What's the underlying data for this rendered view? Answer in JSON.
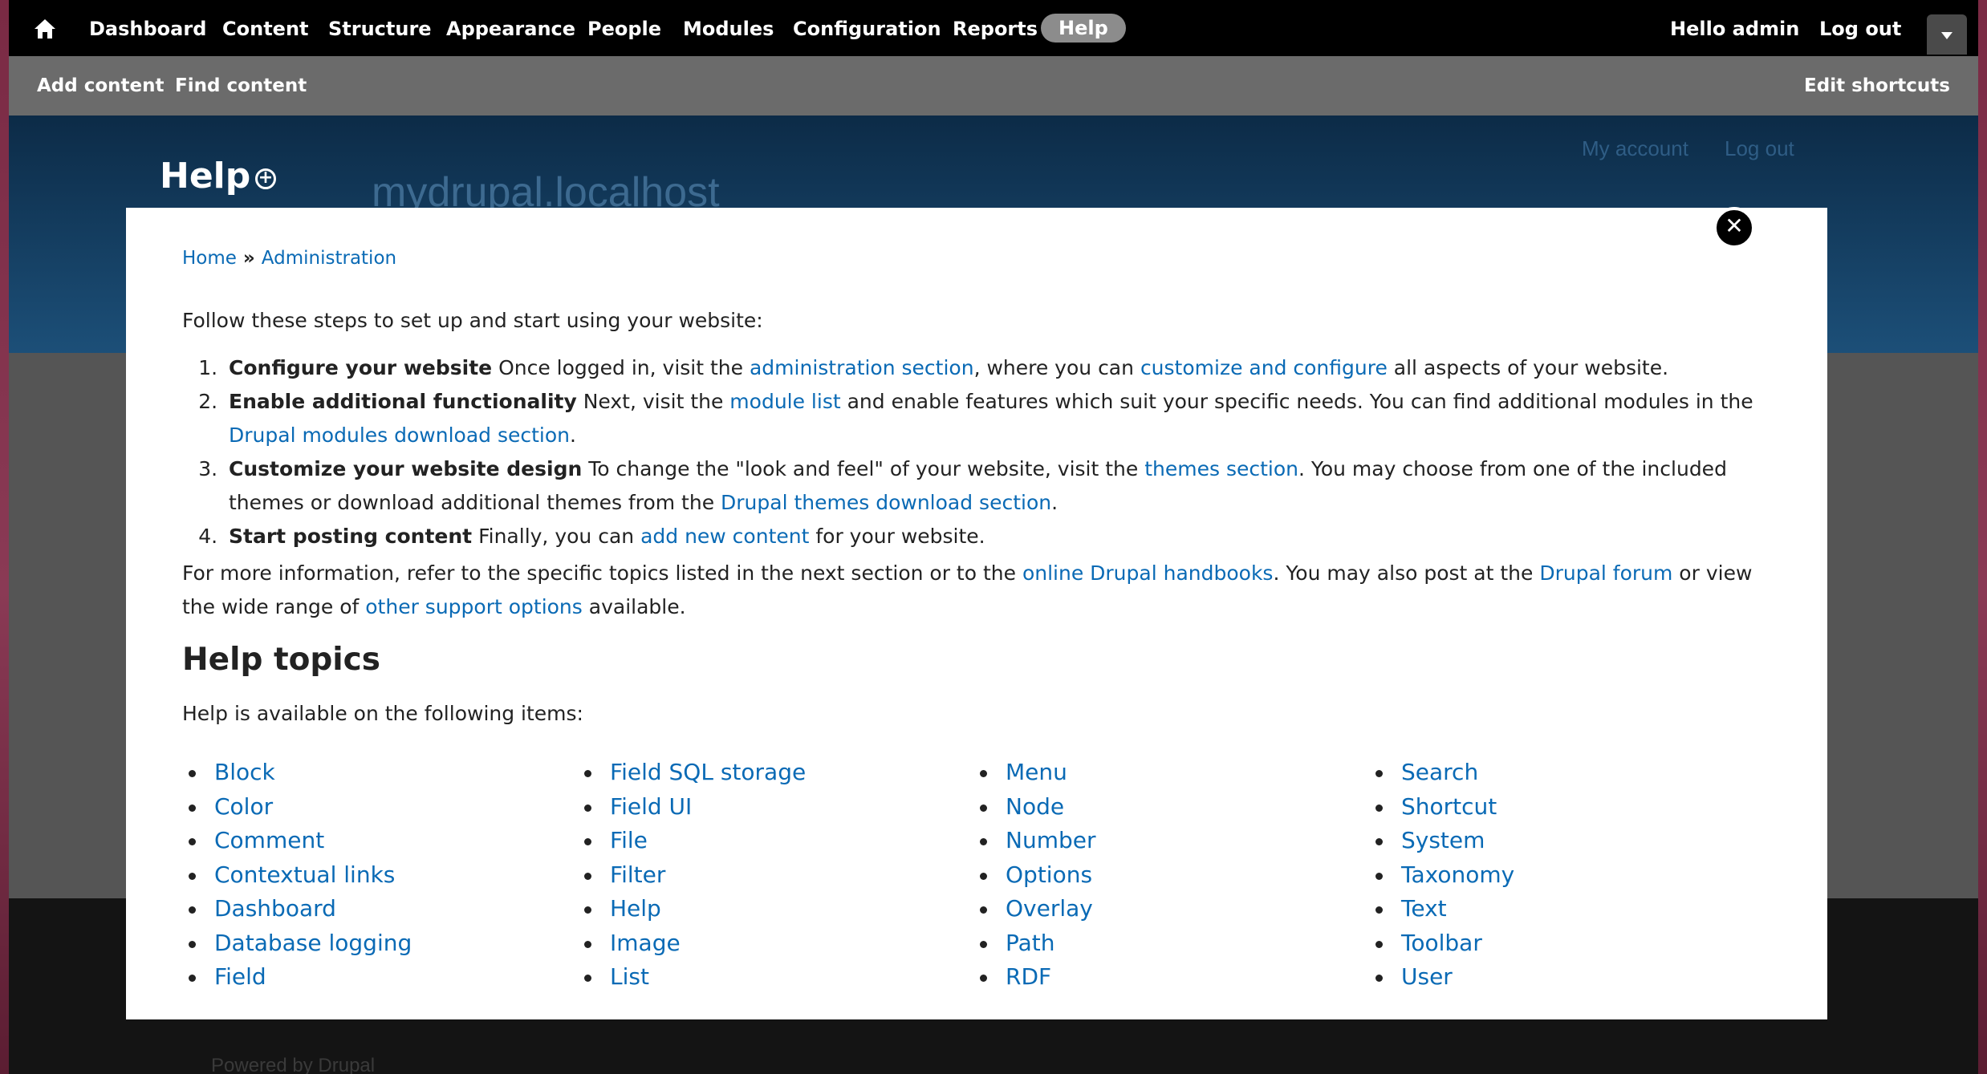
{
  "toolbar": {
    "items": [
      "Dashboard",
      "Content",
      "Structure",
      "Appearance",
      "People",
      "Modules",
      "Configuration",
      "Reports",
      "Help"
    ],
    "hello_prefix": "Hello ",
    "username": "admin",
    "logout": "Log out"
  },
  "shortcuts": {
    "add_content": "Add content",
    "find_content": "Find content",
    "edit_shortcuts": "Edit shortcuts"
  },
  "header": {
    "title": "Help",
    "site_name": "mydrupal.localhost",
    "my_account": "My account",
    "log_out": "Log out"
  },
  "footer": {
    "powered": "Powered by Drupal"
  },
  "overlay": {
    "breadcrumb": {
      "home": "Home",
      "sep": " » ",
      "administration": "Administration"
    },
    "intro": "Follow these steps to set up and start using your website:",
    "steps": [
      {
        "title": "Configure your website",
        "t1": " Once logged in, visit the ",
        "l1": "administration section",
        "t2": ", where you can ",
        "l2": "customize and configure",
        "t3": " all aspects of your website."
      },
      {
        "title": "Enable additional functionality",
        "t1": " Next, visit the ",
        "l1": "module list",
        "t2": " and enable features which suit your specific needs. You can find additional modules in the ",
        "l2": "Drupal modules download section",
        "t3": "."
      },
      {
        "title": "Customize your website design",
        "t1": " To change the \"look and feel\" of your website, visit the ",
        "l1": "themes section",
        "t2": ". You may choose from one of the included themes or download additional themes from the ",
        "l2": "Drupal themes download section",
        "t3": "."
      },
      {
        "title": "Start posting content",
        "t1": " Finally, you can ",
        "l1": "add new content",
        "t2": " for your website."
      }
    ],
    "more_info": {
      "t1": "For more information, refer to the specific topics listed in the next section or to the ",
      "l1": "online Drupal handbooks",
      "t2": ". You may also post at the ",
      "l2": "Drupal forum",
      "t3": " or view the wide range of ",
      "l3": "other support options",
      "t4": " available."
    },
    "help_topics_heading": "Help topics",
    "help_available": "Help is available on the following items:",
    "topics": [
      [
        "Block",
        "Color",
        "Comment",
        "Contextual links",
        "Dashboard",
        "Database logging",
        "Field"
      ],
      [
        "Field SQL storage",
        "Field UI",
        "File",
        "Filter",
        "Help",
        "Image",
        "List"
      ],
      [
        "Menu",
        "Node",
        "Number",
        "Options",
        "Overlay",
        "Path",
        "RDF"
      ],
      [
        "Search",
        "Shortcut",
        "System",
        "Taxonomy",
        "Text",
        "Toolbar",
        "User"
      ]
    ]
  }
}
